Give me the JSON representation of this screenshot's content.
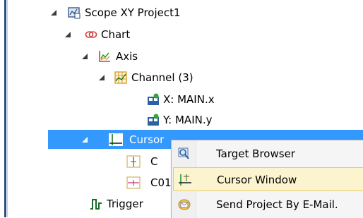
{
  "tree": {
    "project": "Scope XY Project1",
    "chart": "Chart",
    "axis": "Axis",
    "channel": "Channel (3)",
    "x_var": "X: MAIN.x",
    "y_var": "Y: MAIN.y",
    "cursor": "Cursor",
    "cursor_c": "C",
    "cursor_c01": "C01",
    "trigger": "Trigger"
  },
  "context_menu": {
    "items": [
      {
        "label": "Target Browser",
        "icon": "magnifier-icon"
      },
      {
        "label": "Cursor Window",
        "icon": "cursor-window-icon",
        "highlighted": true
      },
      {
        "label": "Send Project By E-Mail.",
        "icon": "email-icon"
      }
    ]
  },
  "colors": {
    "selection": "#3399ff",
    "menu_highlight": "#fcf3cf",
    "menu_highlight_border": "#e8cf6a"
  }
}
